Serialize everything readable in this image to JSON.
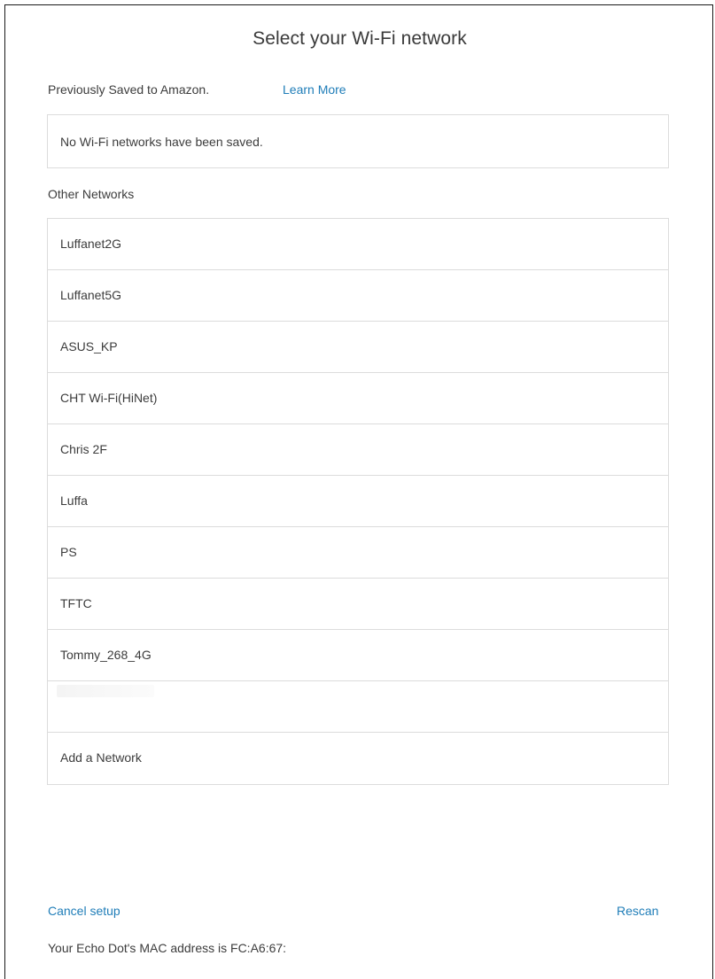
{
  "title": "Select your Wi-Fi network",
  "saved": {
    "label": "Previously Saved to Amazon.",
    "learn_more": "Learn More",
    "empty_message": "No Wi-Fi networks have been saved."
  },
  "other": {
    "label": "Other Networks",
    "networks": [
      "Luffanet2G",
      "Luffanet5G",
      "ASUS_KP",
      "CHT Wi-Fi(HiNet)",
      "Chris 2F",
      "Luffa",
      "PS",
      "TFTC",
      "Tommy_268_4G",
      "",
      "Add a Network"
    ]
  },
  "footer": {
    "cancel": "Cancel setup",
    "rescan": "Rescan",
    "mac_text": "Your Echo Dot's MAC address is FC:A6:67:"
  },
  "colors": {
    "link": "#1f7db8",
    "text": "#3c3c3c",
    "border": "#dcdcdc"
  }
}
